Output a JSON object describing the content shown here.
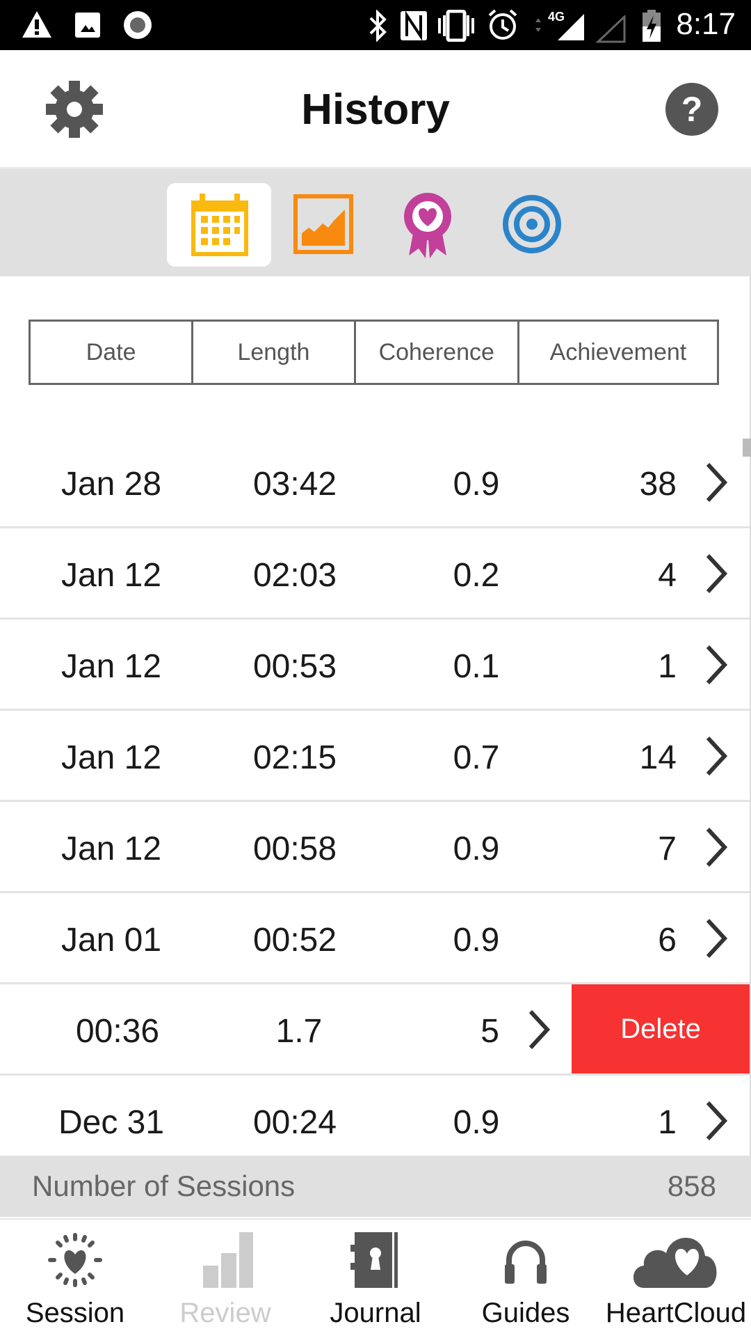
{
  "status_bar": {
    "time": "8:17",
    "network": "4G",
    "icons": [
      "warning-icon",
      "image-icon",
      "record-icon",
      "bluetooth-icon",
      "nfc-icon",
      "vibrate-icon",
      "alarm-icon",
      "signal-icon",
      "signal-empty-icon",
      "battery-charging-icon"
    ]
  },
  "header": {
    "title": "History",
    "left_icon": "gear-icon",
    "right_icon": "help-icon"
  },
  "tabs": [
    {
      "icon": "calendar-icon",
      "color": "#f9b90e",
      "selected": true
    },
    {
      "icon": "area-chart-icon",
      "color": "#f78a0f",
      "selected": false
    },
    {
      "icon": "heart-ribbon-icon",
      "color": "#c23f9a",
      "selected": false
    },
    {
      "icon": "target-icon",
      "color": "#2b84c9",
      "selected": false
    }
  ],
  "columns": [
    "Date",
    "Length",
    "Coherence",
    "Achievement"
  ],
  "rows": [
    {
      "date": "Jan 28",
      "length": "03:42",
      "coherence": "0.9",
      "achievement": "38"
    },
    {
      "date": "Jan 12",
      "length": "02:03",
      "coherence": "0.2",
      "achievement": "4"
    },
    {
      "date": "Jan 12",
      "length": "00:53",
      "coherence": "0.1",
      "achievement": "1"
    },
    {
      "date": "Jan 12",
      "length": "02:15",
      "coherence": "0.7",
      "achievement": "14"
    },
    {
      "date": "Jan 12",
      "length": "00:58",
      "coherence": "0.9",
      "achievement": "7"
    },
    {
      "date": "Jan 01",
      "length": "00:52",
      "coherence": "0.9",
      "achievement": "6"
    },
    {
      "length": "00:36",
      "coherence": "1.7",
      "achievement": "5",
      "delete_label": "Delete"
    },
    {
      "date": "Dec 31",
      "length": "00:24",
      "coherence": "0.9",
      "achievement": "1"
    }
  ],
  "delete_color": "#f63232",
  "summary": {
    "label": "Number of Sessions",
    "value": "858"
  },
  "nav": [
    {
      "label": "Session",
      "icon": "heart-sun-icon"
    },
    {
      "label": "Review",
      "icon": "bar-chart-icon",
      "disabled": true
    },
    {
      "label": "Journal",
      "icon": "journal-icon"
    },
    {
      "label": "Guides",
      "icon": "headphones-icon"
    },
    {
      "label": "HeartCloud",
      "icon": "heart-cloud-icon"
    }
  ]
}
